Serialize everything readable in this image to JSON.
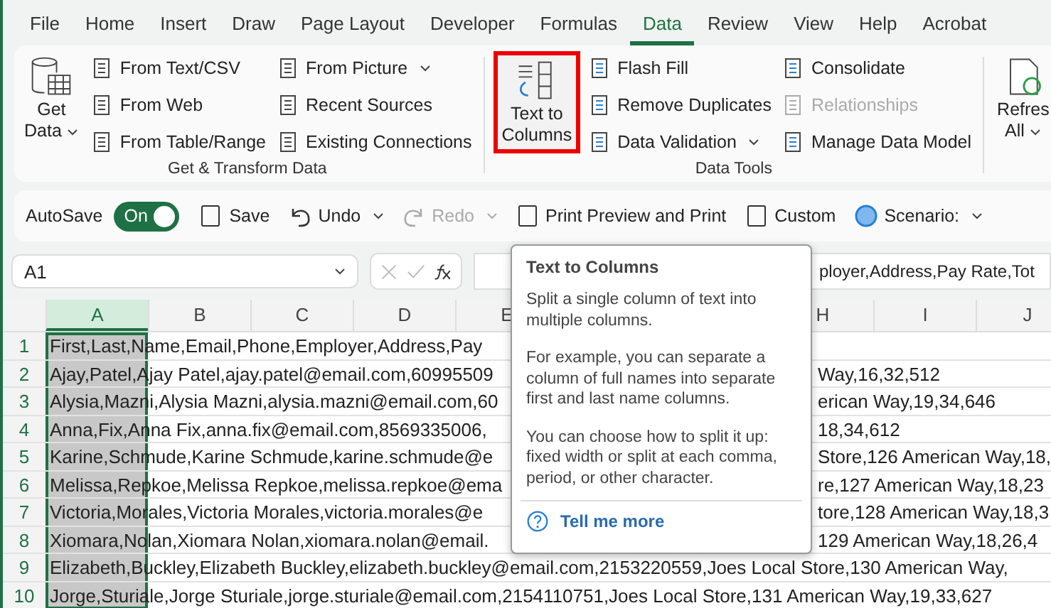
{
  "menu_tabs": [
    {
      "label": "File",
      "selected": false
    },
    {
      "label": "Home",
      "selected": false
    },
    {
      "label": "Insert",
      "selected": false
    },
    {
      "label": "Draw",
      "selected": false
    },
    {
      "label": "Page Layout",
      "selected": false
    },
    {
      "label": "Developer",
      "selected": false
    },
    {
      "label": "Formulas",
      "selected": false
    },
    {
      "label": "Data",
      "selected": true
    },
    {
      "label": "Review",
      "selected": false
    },
    {
      "label": "View",
      "selected": false
    },
    {
      "label": "Help",
      "selected": false
    },
    {
      "label": "Acrobat",
      "selected": false
    }
  ],
  "ribbon_groups": [
    {
      "title": "Get & Transform Data",
      "large": {
        "lines": [
          "Get",
          "Data"
        ],
        "dropdown": true,
        "highlighted": false
      },
      "columns": [
        [
          {
            "label": "From Text/CSV",
            "dropdown": false,
            "disabled": false
          },
          {
            "label": "From Web",
            "dropdown": false,
            "disabled": false
          },
          {
            "label": "From Table/Range",
            "dropdown": false,
            "disabled": false
          }
        ],
        [
          {
            "label": "From Picture",
            "dropdown": true,
            "disabled": false
          },
          {
            "label": "Recent Sources",
            "dropdown": false,
            "disabled": false
          },
          {
            "label": "Existing Connections",
            "dropdown": false,
            "disabled": false
          }
        ]
      ]
    },
    {
      "title": "Data Tools",
      "large": {
        "lines": [
          "Text to",
          "Columns"
        ],
        "dropdown": false,
        "highlighted": true
      },
      "columns": [
        [
          {
            "label": "Flash Fill",
            "dropdown": false,
            "disabled": false
          },
          {
            "label": "Remove Duplicates",
            "dropdown": false,
            "disabled": false
          },
          {
            "label": "Data Validation",
            "dropdown": true,
            "disabled": false
          }
        ],
        [
          {
            "label": "Consolidate",
            "dropdown": false,
            "disabled": false
          },
          {
            "label": "Relationships",
            "dropdown": false,
            "disabled": true
          },
          {
            "label": "Manage Data Model",
            "dropdown": false,
            "disabled": false
          }
        ]
      ]
    },
    {
      "large": {
        "lines": [
          "Refres",
          "All"
        ],
        "dropdown": true,
        "highlighted": false
      }
    }
  ],
  "quick_access": {
    "autosave_label": "AutoSave",
    "autosave": {
      "label": "On",
      "on": true
    },
    "items": [
      {
        "label": "Save",
        "dropdown": false,
        "disabled": false
      },
      {
        "label": "Undo",
        "dropdown": true,
        "disabled": false
      },
      {
        "label": "Redo",
        "dropdown": true,
        "disabled": true
      },
      {
        "label": "Print Preview and Print",
        "dropdown": false,
        "disabled": false
      },
      {
        "label": "Custom",
        "dropdown": false,
        "disabled": false
      },
      {
        "label": "Scenario:",
        "dropdown": true,
        "disabled": false
      }
    ]
  },
  "formula_bar": {
    "name_box": "A1",
    "formula": "ployer,Address,Pay Rate,Tot"
  },
  "columns": [
    {
      "label": "A",
      "selected": true
    },
    {
      "label": "B",
      "selected": false
    },
    {
      "label": "C",
      "selected": false
    },
    {
      "label": "D",
      "selected": false
    },
    {
      "label": "E",
      "selected": false
    },
    {
      "label": "H",
      "selected": false
    },
    {
      "label": "I",
      "selected": false
    },
    {
      "label": "J",
      "selected": false
    }
  ],
  "rows": [
    {
      "number": "1",
      "segments": [
        "First,Last,Name,Email,Phone,Employer,Address,Pay"
      ]
    },
    {
      "number": "2",
      "segments": [
        "Ajay,Patel,Ajay Patel,ajay.patel@email.com,60995509",
        "Way,16,32,512"
      ]
    },
    {
      "number": "3",
      "segments": [
        "Alysia,Mazni,Alysia Mazni,alysia.mazni@email.com,60",
        "erican Way,19,34,646"
      ]
    },
    {
      "number": "4",
      "segments": [
        "Anna,Fix,Anna Fix,anna.fix@email.com,8569335006,",
        "18,34,612"
      ]
    },
    {
      "number": "5",
      "segments": [
        "Karine,Schmude,Karine Schmude,karine.schmude@e",
        "Store,126 American Way,18,"
      ]
    },
    {
      "number": "6",
      "segments": [
        "Melissa,Repkoe,Melissa Repkoe,melissa.repkoe@ema",
        "re,127 American Way,18,23"
      ]
    },
    {
      "number": "7",
      "segments": [
        "Victoria,Morales,Victoria Morales,victoria.morales@e",
        "tore,128 American Way,18,3"
      ]
    },
    {
      "number": "8",
      "segments": [
        "Xiomara,Nolan,Xiomara Nolan,xiomara.nolan@email.",
        "129 American Way,18,26,4"
      ]
    },
    {
      "number": "9",
      "segments": [
        "Elizabeth,Buckley,Elizabeth Buckley,elizabeth.buckley@email.com,2153220559,Joes Local Store,130 American Way,"
      ]
    },
    {
      "number": "10",
      "segments": [
        "Jorge,Sturiale,Jorge Sturiale,jorge.sturiale@email.com,2154110751,Joes Local Store,131 American Way,19,33,627"
      ]
    }
  ],
  "tooltip": {
    "title": "Text to Columns",
    "paragraphs": [
      "Split a single column of text into multiple columns.",
      "For example, you can separate a column of full names into separate first and last name columns.",
      "You can choose how to split it up: fixed width or split at each comma, period, or other character."
    ],
    "link": "Tell me more"
  }
}
